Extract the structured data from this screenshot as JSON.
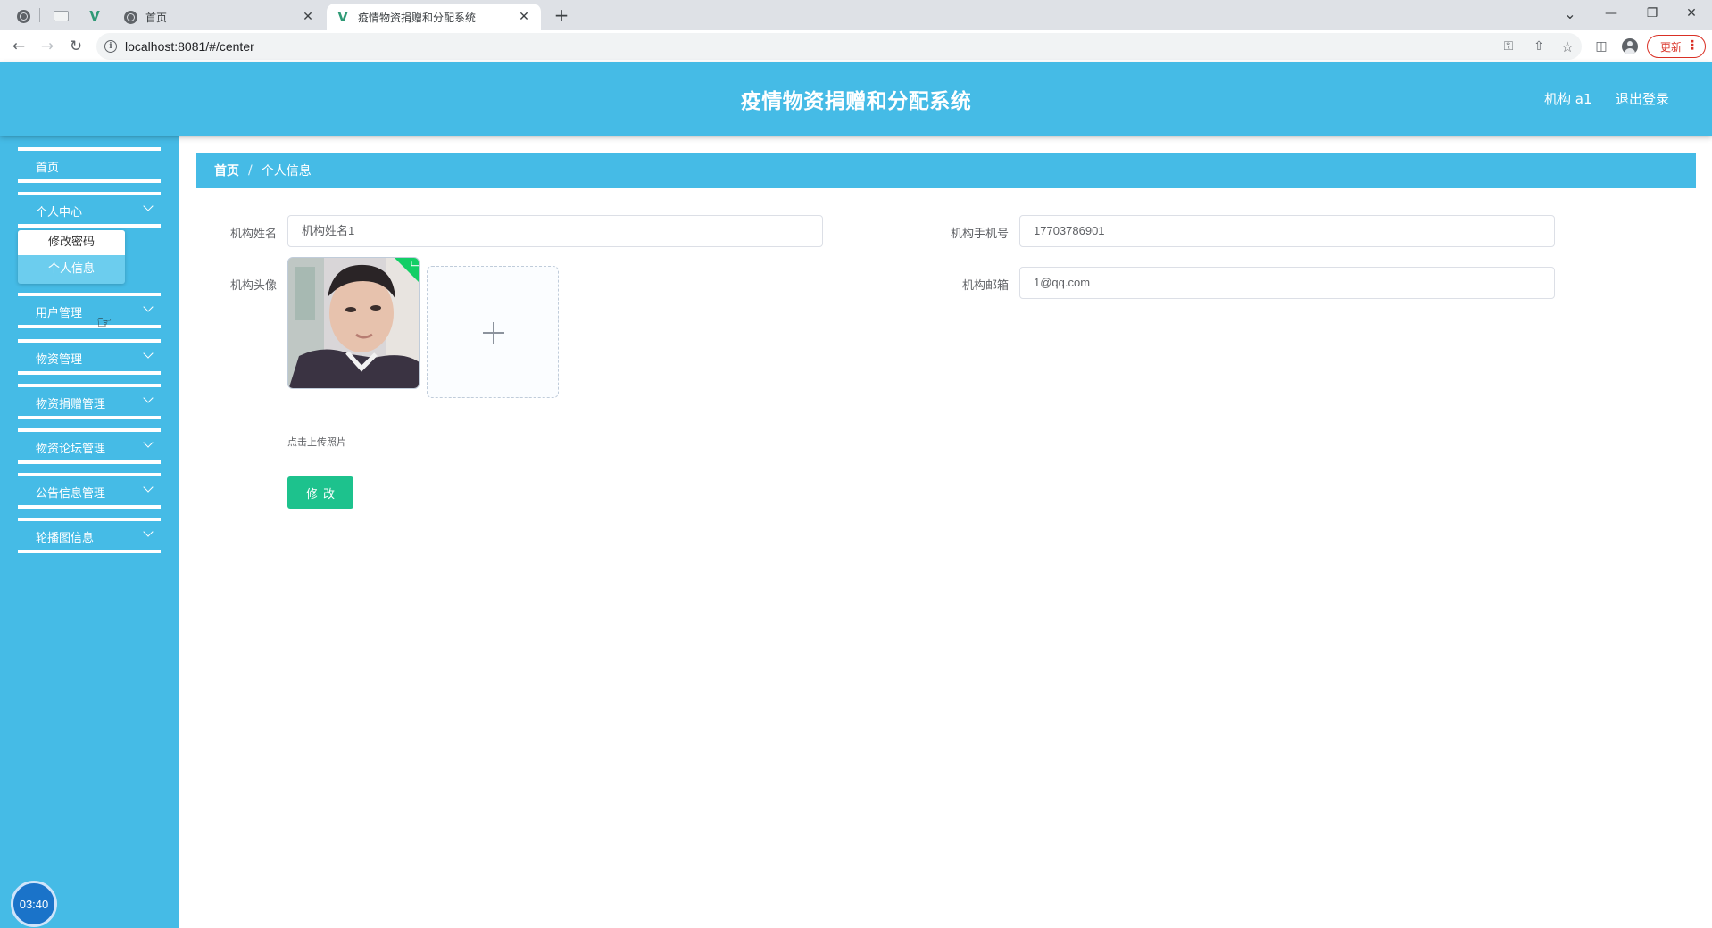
{
  "browser": {
    "tabs": [
      {
        "title": "首页",
        "close": "✕"
      },
      {
        "title": "疫情物资捐赠和分配系统",
        "close": "✕"
      }
    ],
    "new_tab": "+",
    "window_controls": {
      "minimize": "—",
      "restore": "❐",
      "close": "✕",
      "tab_search": "⌄"
    },
    "url": "localhost:8081/#/center",
    "update_label": "更新",
    "menu_dots": "⋮"
  },
  "header": {
    "title": "疫情物资捐赠和分配系统",
    "user": "机构 a1",
    "logout": "退出登录"
  },
  "sidebar": {
    "items": [
      {
        "label": "首页"
      },
      {
        "label": "个人中心"
      },
      {
        "label": "用户管理"
      },
      {
        "label": "物资管理"
      },
      {
        "label": "物资捐赠管理"
      },
      {
        "label": "物资论坛管理"
      },
      {
        "label": "公告信息管理"
      },
      {
        "label": "轮播图信息"
      }
    ],
    "submenu": [
      {
        "label": "修改密码"
      },
      {
        "label": "个人信息"
      }
    ],
    "timer": "03:40"
  },
  "breadcrumb": {
    "home": "首页",
    "separator": "/",
    "current": "个人信息"
  },
  "form": {
    "name_label": "机构姓名",
    "name_value": "机构姓名1",
    "phone_label": "机构手机号",
    "phone_value": "17703786901",
    "avatar_label": "机构头像",
    "email_label": "机构邮箱",
    "email_value": "1@qq.com",
    "upload_tip": "点击上传照片",
    "submit_label": "修改"
  },
  "colors": {
    "primary": "#45bbe6",
    "submit": "#1dc28d",
    "update_red": "#d93025"
  }
}
